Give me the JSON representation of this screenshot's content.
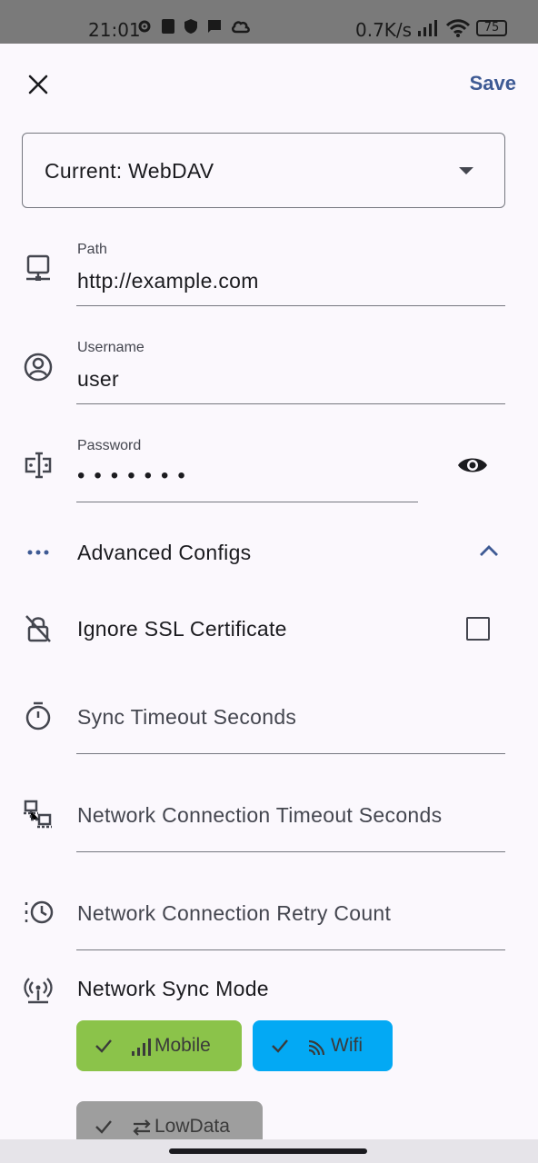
{
  "status_bar": {
    "time": "21:01",
    "net_speed": "0.7K/s",
    "battery": "75"
  },
  "header": {
    "close_icon": "close-icon",
    "save_label": "Save"
  },
  "sync_type": {
    "selected": "Current: WebDAV"
  },
  "form": {
    "path": {
      "label": "Path",
      "value": "http://example.com",
      "icon": "server-icon"
    },
    "username": {
      "label": "Username",
      "value": "user",
      "icon": "account-icon"
    },
    "password": {
      "label": "Password",
      "value": "•••••••",
      "icon": "password-icon"
    }
  },
  "advanced": {
    "title": "Advanced Configs",
    "ignore_ssl": {
      "label": "Ignore SSL Certificate",
      "checked": false
    },
    "sync_timeout": {
      "placeholder": "Sync Timeout Seconds"
    },
    "network_timeout": {
      "placeholder": "Network Connection Timeout Seconds"
    },
    "retry_count": {
      "placeholder": "Network Connection Retry Count"
    },
    "sync_mode": {
      "title": "Network Sync Mode",
      "chips": [
        {
          "label": "Mobile",
          "selected": true,
          "color": "#8bc34a"
        },
        {
          "label": "Wifi",
          "selected": true,
          "color": "#03a9f4"
        },
        {
          "label": "LowData",
          "selected": true,
          "color": "#9e9e9e"
        }
      ]
    }
  },
  "colors": {
    "accent": "#3e5a94",
    "background": "#fbf8fd",
    "outline": "#75777f"
  }
}
